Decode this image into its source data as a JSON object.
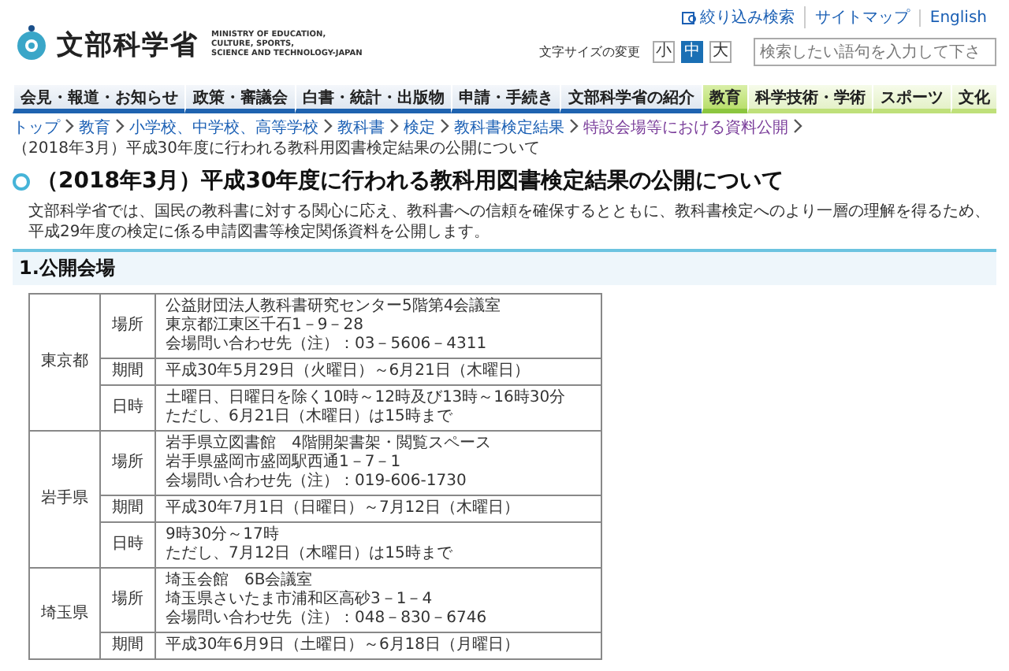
{
  "header": {
    "logo_text": "文部科学省",
    "logo_subtitle": [
      "MINISTRY OF EDUCATION,",
      "CULTURE, SPORTS,",
      "SCIENCE AND TECHNOLOGY-JAPAN"
    ],
    "top_links": [
      "絞り込み検索",
      "サイトマップ",
      "English"
    ],
    "font_size": {
      "label": "文字サイズの変更",
      "options": [
        {
          "label": "小",
          "selected": false
        },
        {
          "label": "中",
          "selected": true
        },
        {
          "label": "大",
          "selected": false
        }
      ]
    },
    "search": {
      "placeholder": "検索したい語句を入力して下さ"
    }
  },
  "nav": [
    {
      "label": "会見・報道・お知らせ",
      "kind": "ministry",
      "selected": false
    },
    {
      "label": "政策・審議会",
      "kind": "ministry",
      "selected": false
    },
    {
      "label": "白書・統計・出版物",
      "kind": "ministry",
      "selected": false
    },
    {
      "label": "申請・手続き",
      "kind": "ministry",
      "selected": false
    },
    {
      "label": "文部科学省の紹介",
      "kind": "ministry",
      "selected": false
    },
    {
      "label": "教育",
      "kind": "field",
      "selected": true
    },
    {
      "label": "科学技術・学術",
      "kind": "field",
      "selected": false
    },
    {
      "label": "スポーツ",
      "kind": "field",
      "selected": false
    },
    {
      "label": "文化",
      "kind": "field",
      "selected": false
    }
  ],
  "breadcrumb": [
    {
      "label": "トップ",
      "kind": "link"
    },
    {
      "label": "教育",
      "kind": "link"
    },
    {
      "label": "小学校、中学校、高等学校",
      "kind": "link"
    },
    {
      "label": "教科書",
      "kind": "link"
    },
    {
      "label": "検定",
      "kind": "link"
    },
    {
      "label": "教科書検定結果",
      "kind": "link"
    },
    {
      "label": "特設会場等における資料公開",
      "kind": "visited"
    },
    {
      "label": "（2018年3月）平成30年度に行われる教科用図書検定結果の公開について",
      "kind": "current"
    }
  ],
  "title": "（2018年3月）平成30年度に行われる教科用図書検定結果の公開について",
  "intro": "文部科学省では、国民の教科書に対する関心に応え、教科書への信頼を確保するとともに、教科書検定へのより一層の理解を得るため、平成29年度の検定に係る申請図書等検定関係資料を公開します。",
  "section_heading": "1.公開会場",
  "venues": [
    {
      "prefecture": "東京都",
      "rows": [
        {
          "label": "場所",
          "lines": [
            "公益財団法人教科書研究センター5階第4会議室",
            "東京都江東区千石1－9－28",
            "会場問い合わせ先（注）：03－5606－4311"
          ]
        },
        {
          "label": "期間",
          "lines": [
            "平成30年5月29日（火曜日）～6月21日（木曜日）"
          ]
        },
        {
          "label": "日時",
          "lines": [
            "土曜日、日曜日を除く10時～12時及び13時～16時30分",
            "ただし、6月21日（木曜日）は15時まで"
          ]
        }
      ]
    },
    {
      "prefecture": "岩手県",
      "rows": [
        {
          "label": "場所",
          "lines": [
            "岩手県立図書館　4階開架書架・閲覧スペース",
            "岩手県盛岡市盛岡駅西通1－7－1",
            "会場問い合わせ先（注）：019-606-1730"
          ]
        },
        {
          "label": "期間",
          "lines": [
            "平成30年7月1日（日曜日）～7月12日（木曜日）"
          ]
        },
        {
          "label": "日時",
          "lines": [
            "9時30分～17時",
            "ただし、7月12日（木曜日）は15時まで"
          ]
        }
      ]
    },
    {
      "prefecture": "埼玉県",
      "rows": [
        {
          "label": "場所",
          "lines": [
            "埼玉会館　6B会議室",
            "埼玉県さいたま市浦和区高砂3－1－4",
            "会場問い合わせ先（注）：048－830－6746"
          ]
        },
        {
          "label": "期間",
          "lines": [
            "平成30年6月9日（土曜日）～6月18日（月曜日）"
          ]
        }
      ]
    }
  ]
}
